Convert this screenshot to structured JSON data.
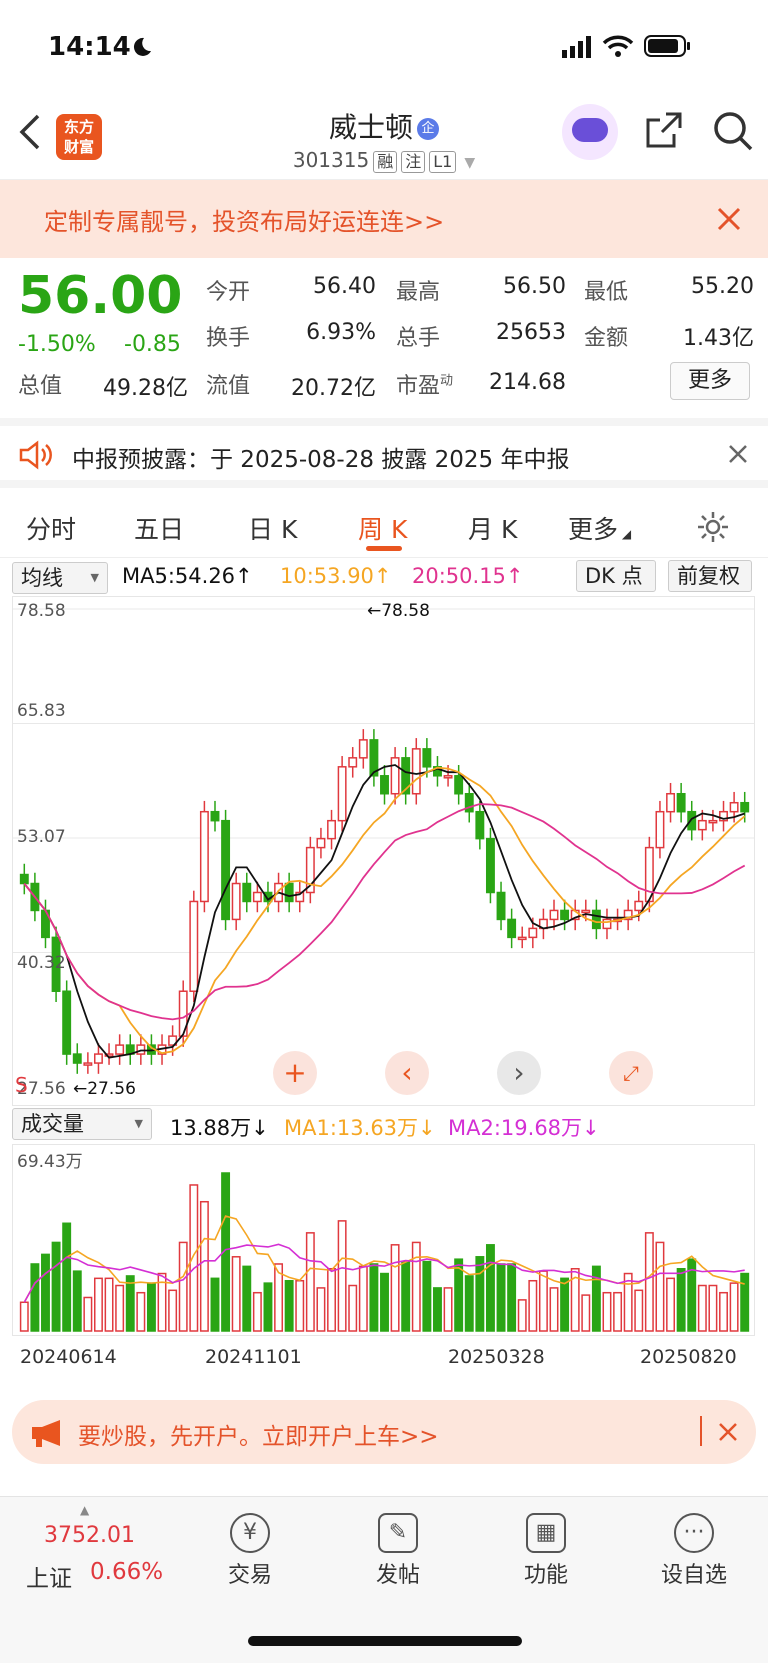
{
  "status": {
    "time": "14:14"
  },
  "header": {
    "logo": "东方\n财富",
    "name": "威士顿",
    "badge": "企",
    "code": "301315",
    "tags": [
      "融",
      "注",
      "L1"
    ]
  },
  "banner": {
    "text": "定制专属靓号，投资布局好运连连>>"
  },
  "quote": {
    "price": "56.00",
    "pct": "-1.50%",
    "chg": "-0.85",
    "row1": [
      [
        "今开",
        "56.40"
      ],
      [
        "最高",
        "56.50"
      ],
      [
        "最低",
        "55.20"
      ]
    ],
    "row2": [
      [
        "换手",
        "6.93%"
      ],
      [
        "总手",
        "25653"
      ],
      [
        "金额",
        "1.43亿"
      ]
    ],
    "row3": [
      [
        "总值",
        "49.28亿"
      ],
      [
        "流值",
        "20.72亿"
      ],
      [
        "市盈",
        "214.68"
      ]
    ],
    "row3_sup": "动",
    "more": "更多"
  },
  "notice": {
    "text": "中报预披露：于 2025-08-28 披露 2025 年中报"
  },
  "tabs": [
    "分时",
    "五日",
    "日 K",
    "周 K",
    "月 K",
    "更多"
  ],
  "ma_bar": {
    "select": "均线",
    "ma5": "MA5:54.26",
    "ma10": "10:53.90",
    "ma20": "20:50.15",
    "dk": "DK 点",
    "fq": "前复权"
  },
  "chart_data": {
    "type": "candlestick",
    "y_ticks": [
      "78.58",
      "65.83",
      "53.07",
      "40.32",
      "27.56"
    ],
    "high_label": "←78.58",
    "low_label": "←27.56",
    "ylim": [
      27.56,
      78.58
    ],
    "s_marks": [
      "S",
      "S"
    ],
    "closes": [
      48,
      45,
      42,
      36,
      29,
      28,
      28,
      29,
      29,
      30,
      29,
      30,
      29,
      30,
      31,
      36,
      46,
      56,
      55,
      44,
      48,
      46,
      47,
      46,
      48,
      46,
      47,
      52,
      53,
      55,
      61,
      62,
      64,
      60,
      58,
      62,
      58,
      63,
      61,
      60,
      60,
      58,
      56,
      53,
      47,
      44,
      42,
      42,
      43,
      44,
      45,
      44,
      45,
      45,
      43,
      44,
      44,
      45,
      46,
      52,
      56,
      58,
      56,
      54,
      55,
      55,
      56,
      57,
      56
    ]
  },
  "volume_bar": {
    "select": "成交量",
    "val": "13.88万",
    "ma1": "MA1:13.63万",
    "ma2": "MA2:19.68万",
    "top": "69.43万",
    "dates": [
      "20240614",
      "20241101",
      "20250328",
      "20250820"
    ]
  },
  "ad": {
    "text": "要炒股，先开户。立即开户上车>>"
  },
  "bottom": {
    "index_val": "3752.01",
    "index_name": "上证",
    "index_pct": "0.66%",
    "items": [
      "交易",
      "发帖",
      "功能",
      "设自选"
    ]
  },
  "colors": {
    "up": "#e0393e",
    "down": "#2aa515",
    "accent": "#e9551f",
    "ma5": "#111111",
    "ma10": "#f5a623",
    "ma20": "#e0338f"
  }
}
